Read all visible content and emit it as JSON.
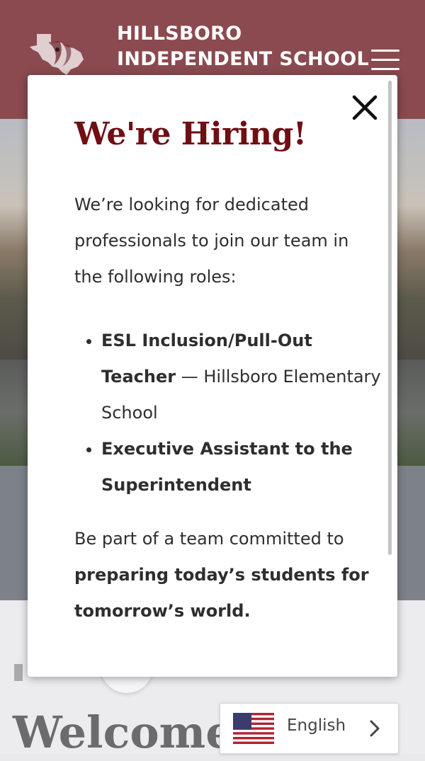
{
  "header": {
    "school_line1": "HILLSBORO",
    "school_line2": "INDEPENDENT SCHOOL",
    "brand_color": "#8a4a4f",
    "logo_icon": "texas-eagle-logo-icon",
    "menu_icon": "hamburger-menu-icon"
  },
  "modal": {
    "heading": "We're Hiring!",
    "intro": "We’re looking for dedicated professionals to join our team in the following roles:",
    "roles": [
      {
        "title": "ESL Inclusion/Pull-Out Teacher",
        "separator": " — ",
        "location": "Hillsboro Elementary School"
      },
      {
        "title": "Executive Assistant to the Superintendent",
        "separator": "",
        "location": ""
      }
    ],
    "closing_prefix": "Be part of a team committed to ",
    "closing_bold": "preparing today’s students for tomorrow’s world.",
    "heading_color": "#6e0f14",
    "close_icon": "close-icon"
  },
  "page": {
    "welcome_text": "Welcome t"
  },
  "language": {
    "selected": "English",
    "flag_icon": "us-flag-icon",
    "chevron_icon": "chevron-right-icon"
  }
}
